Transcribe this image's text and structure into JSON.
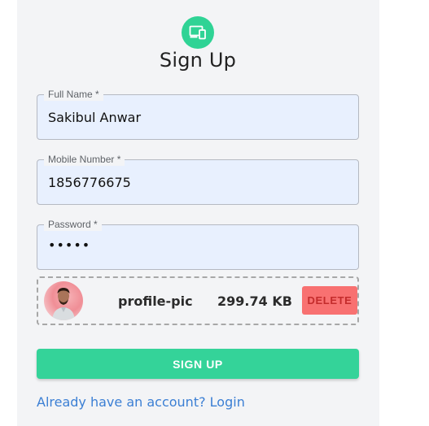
{
  "form": {
    "title": "Sign Up",
    "logo_icon": "devices-icon",
    "accent_color": "#34d399"
  },
  "fields": {
    "full_name": {
      "label": "Full Name *",
      "value": "Sakibul Anwar"
    },
    "mobile": {
      "label": "Mobile Number *",
      "value": "1856776675"
    },
    "password": {
      "label": "Password *",
      "value": "•••••"
    }
  },
  "upload": {
    "file_name": "profile-pic",
    "file_size": "299.74 KB",
    "delete_label": "DELETE"
  },
  "actions": {
    "signup_label": "SIGN UP",
    "login_link": "Already have an account? Login"
  }
}
